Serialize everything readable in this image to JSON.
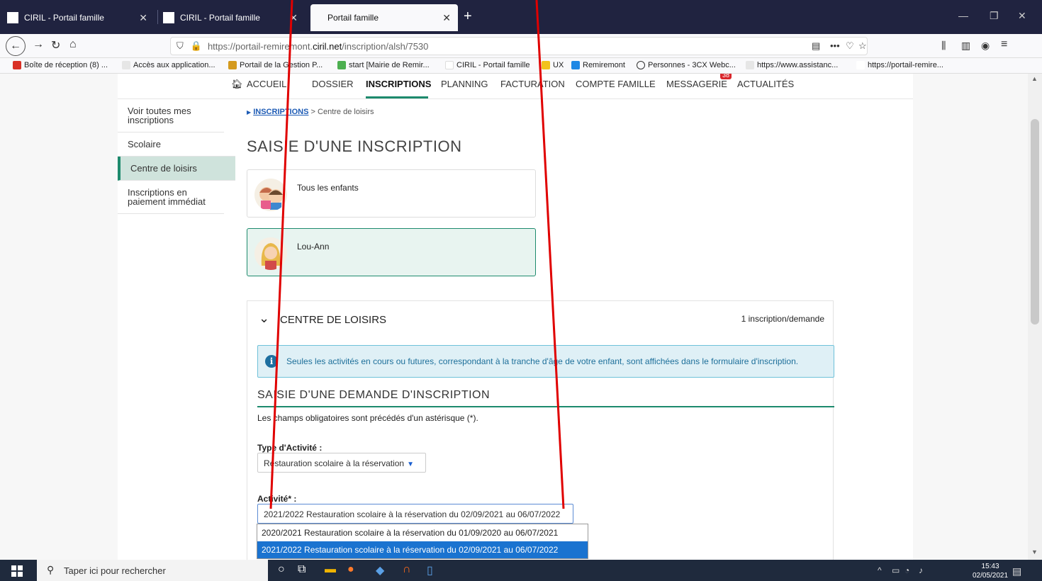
{
  "browser": {
    "tabs": [
      {
        "label": "CIRIL - Portail famille",
        "close": "✕"
      },
      {
        "label": "CIRIL - Portail famille",
        "close": "✕"
      },
      {
        "label": "Portail famille",
        "close": "✕"
      }
    ],
    "new_tab": "+",
    "window_controls": {
      "minimize": "—",
      "restore": "❐",
      "close": "✕"
    },
    "url": {
      "prefix": "https://portail-remiremont.",
      "domain": "ciril.net",
      "path": "/inscription/alsh/7530"
    },
    "bookmarks": [
      "Boîte de réception (8) ...",
      "Accès aux application...",
      "Portail de la Gestion P...",
      "start [Mairie de Remir...",
      "CIRIL - Portail famille",
      "UX",
      "Remiremont",
      "Personnes - 3CX Webc...",
      "https://www.assistanc...",
      "https://portail-remire..."
    ]
  },
  "topnav": {
    "items": [
      "ACCUEIL",
      "DOSSIER",
      "INSCRIPTIONS",
      "PLANNING",
      "FACTURATION",
      "COMPTE FAMILLE",
      "MESSAGERIE",
      "ACTUALITÉS"
    ],
    "messagerie_badge": "38"
  },
  "sidemenu": {
    "items": [
      "Voir toutes mes inscriptions",
      "Scolaire",
      "Centre de loisirs",
      "Inscriptions en paiement immédiat"
    ]
  },
  "breadcrumb": {
    "link": "INSCRIPTIONS",
    "sep": ">",
    "current": "Centre de loisirs"
  },
  "page_title": "SAISIE D'UNE INSCRIPTION",
  "children": [
    {
      "name": "Tous les enfants",
      "selected": false
    },
    {
      "name": "Lou-Ann",
      "selected": true
    }
  ],
  "panel": {
    "title": "CENTRE DE LOISIRS",
    "count": "1 inscription/demande",
    "info": "Seules les activités en cours ou futures, correspondant à la tranche d'âge de votre enfant, sont affichées dans le formulaire d'inscription.",
    "form_title": "SAISIE D'UNE DEMANDE D'INSCRIPTION",
    "required_note": "Les champs obligatoires sont précédés d'un astérisque (*).",
    "type_label": "Type d'Activité :",
    "type_value": "Restauration scolaire à la réservation",
    "activite_label": "Activité* :",
    "activite_value": "2021/2022 Restauration scolaire à la réservation du 02/09/2021 au 06/07/2022",
    "options": [
      "2020/2021 Restauration scolaire à la réservation du 01/09/2020 au 06/07/2021",
      "2021/2022 Restauration scolaire à la réservation du 02/09/2021 au 06/07/2022"
    ],
    "selected_option_index": 1
  },
  "taskbar": {
    "search_placeholder": "Taper ici pour rechercher",
    "time": "15:43",
    "date": "02/05/2021"
  },
  "colors": {
    "accent": "#1d8a6d",
    "annotation": "#e00000",
    "selection": "#1a73d0"
  }
}
